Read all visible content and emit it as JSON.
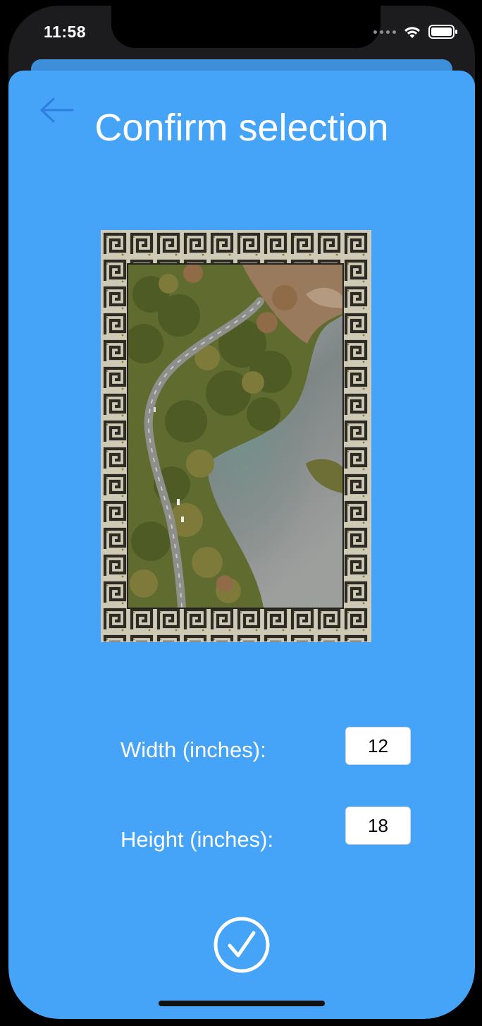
{
  "status_bar": {
    "time": "11:58",
    "icons": [
      "cellular-signal-icon",
      "wifi-icon",
      "battery-icon"
    ]
  },
  "header": {
    "title": "Confirm selection",
    "back_icon": "arrow-left-icon"
  },
  "artwork": {
    "description_icon": "framed-image"
  },
  "form": {
    "width_label": "Width (inches):",
    "width_value": "12",
    "height_label": "Height (inches):",
    "height_value": "18"
  },
  "actions": {
    "confirm_icon": "check-circle-icon"
  },
  "colors": {
    "sheet_background": "#45a3f8",
    "back_arrow": "#2f7de0",
    "text": "#ffffff"
  }
}
